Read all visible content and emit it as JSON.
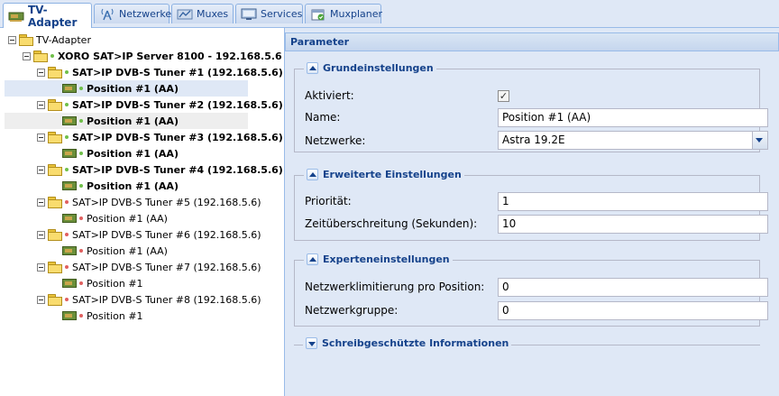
{
  "tabs": [
    {
      "label": "TV-Adapter",
      "icon": "tv-card-icon",
      "active": true
    },
    {
      "label": "Netzwerke",
      "icon": "antenna-icon",
      "active": false
    },
    {
      "label": "Muxes",
      "icon": "mux-icon",
      "active": false
    },
    {
      "label": "Services",
      "icon": "tv-screen-icon",
      "active": false
    },
    {
      "label": "Muxplaner",
      "icon": "calendar-check-icon",
      "active": false
    }
  ],
  "tree": {
    "root": "TV-Adapter",
    "server": "XORO SAT>IP Server 8100 - 192.168.5.6",
    "tuners": [
      {
        "label": "SAT>IP DVB-S Tuner #1 (192.168.5.6)",
        "status": "green",
        "position": "Position #1 (AA)"
      },
      {
        "label": "SAT>IP DVB-S Tuner #2 (192.168.5.6)",
        "status": "green",
        "position": "Position #1 (AA)"
      },
      {
        "label": "SAT>IP DVB-S Tuner #3 (192.168.5.6)",
        "status": "green",
        "position": "Position #1 (AA)"
      },
      {
        "label": "SAT>IP DVB-S Tuner #4 (192.168.5.6)",
        "status": "green",
        "position": "Position #1 (AA)"
      },
      {
        "label": "SAT>IP DVB-S Tuner #5 (192.168.5.6)",
        "status": "red",
        "position": "Position #1 (AA)"
      },
      {
        "label": "SAT>IP DVB-S Tuner #6 (192.168.5.6)",
        "status": "red",
        "position": "Position #1 (AA)"
      },
      {
        "label": "SAT>IP DVB-S Tuner #7 (192.168.5.6)",
        "status": "red",
        "position": "Position #1"
      },
      {
        "label": "SAT>IP DVB-S Tuner #8 (192.168.5.6)",
        "status": "red",
        "position": "Position #1"
      }
    ]
  },
  "params": {
    "title": "Parameter",
    "basic": {
      "legend": "Grundeinstellungen",
      "enabled_label": "Aktiviert:",
      "enabled_value": "✓",
      "name_label": "Name:",
      "name_value": "Position #1 (AA)",
      "networks_label": "Netzwerke:",
      "networks_value": "Astra 19.2E"
    },
    "advanced": {
      "legend": "Erweiterte Einstellungen",
      "priority_label": "Priorität:",
      "priority_value": "1",
      "timeout_label": "Zeitüberschreitung (Sekunden):",
      "timeout_value": "10"
    },
    "expert": {
      "legend": "Experteneinstellungen",
      "netlimit_label": "Netzwerklimitierung pro Position:",
      "netlimit_value": "0",
      "netgroup_label": "Netzwerkgruppe:",
      "netgroup_value": "0"
    },
    "readonly": {
      "legend": "Schreibgeschützte Informationen"
    }
  }
}
